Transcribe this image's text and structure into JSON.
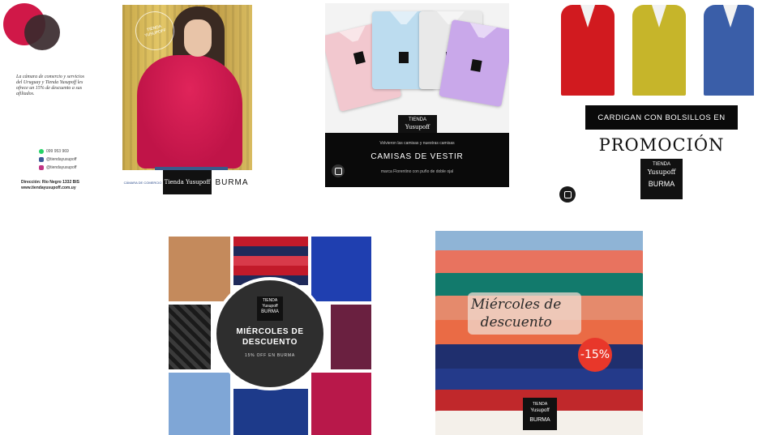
{
  "tile1": {
    "body_text": "La cámara de comercio y servicios del Uruguay y Tienda Yusupoff les ofrece un 15% de descuento a sus afiliados.",
    "contacts": [
      {
        "icon": "whatsapp-icon",
        "text": "099 953 969",
        "color": "#25d366"
      },
      {
        "icon": "facebook-icon",
        "text": "@tiendayusupoff",
        "color": "#3b5998"
      },
      {
        "icon": "instagram-icon",
        "text": "@tiendayusupoff",
        "color": "#c13584"
      }
    ],
    "address_line1": "Dirección: Río Negro 1332 BIS",
    "address_line2": "www.tiendayusupoff.com.uy",
    "colors": {
      "red_circle": "#d01848",
      "dark_circle": "#3a2a2e"
    }
  },
  "tile2": {
    "stamp": "TIENDA YUSUPOFF",
    "logos": [
      "CÁMARA DE COMERCIO",
      "Tienda Yusupoff",
      "BURMA"
    ]
  },
  "tile3": {
    "brand_line1": "TIENDA",
    "brand_line2": "Yusupoff",
    "subtitle": "Volvieron las camisas y nuestras camisas",
    "headline": "CAMISAS DE VESTIR",
    "footer": "marca Florentino con puño de doble ojal",
    "shirt_colors": [
      "#f2c8cf",
      "#bcdcef",
      "#e9e9e9",
      "#c9a8ea"
    ]
  },
  "tile4": {
    "banner": "CARDIGAN CON BOLSILLOS EN",
    "headline": "PROMOCIÓN",
    "brand_line1": "TIENDA",
    "brand_line2": "Yusupoff",
    "brand_line3": "BURMA",
    "cardigan_colors": [
      "#d11a1f",
      "#c6b52a",
      "#3a5ea8"
    ]
  },
  "tile5": {
    "brand_line1": "TIENDA",
    "brand_line2": "Yusupoff",
    "brand_line3": "BURMA",
    "headline_line1": "MIÉRCOLES DE",
    "headline_line2": "DESCUENTO",
    "subtitle": "15% OFF EN BURMA"
  },
  "tile6": {
    "script_line1": "Miércoles de",
    "script_line2": "descuento",
    "discount": "-15%",
    "brand_line1": "TIENDA",
    "brand_line2": "Yusupoff",
    "brand_line3": "BURMA",
    "band_colors": [
      "#8fb4d6",
      "#e8735f",
      "#127a6c",
      "#e58a6c",
      "#ea6b45",
      "#1f2f6e",
      "#243a8a",
      "#c0282b",
      "#f4f0ea"
    ]
  }
}
